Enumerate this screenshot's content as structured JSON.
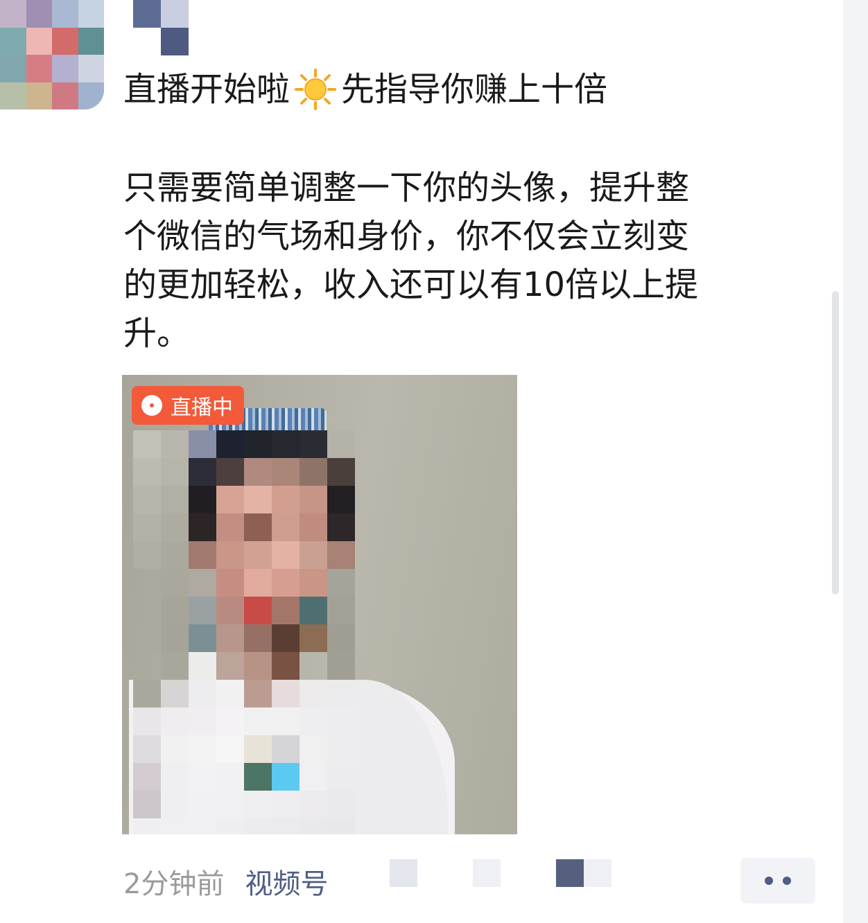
{
  "post": {
    "title_part1": "直播开始啦",
    "title_icon": "sun-icon",
    "title_part2": "先指导你赚上十倍",
    "body_lines": [
      "只需要简单调整一下你的头像，提升整",
      "个微信的气场和身价，你不仅会立刻变",
      "的更加轻松，收入还可以有10倍以上提",
      "升。"
    ]
  },
  "video": {
    "badge_icon": "live-dot-icon",
    "badge_label": "直播中",
    "badge_color": "#f25a3a"
  },
  "footer": {
    "timestamp": "2分钟前",
    "channel_label": "视频号",
    "more_icon": "more-dots-icon"
  },
  "colors": {
    "link": "#4f5d87",
    "timestamp": "#9a9a9a",
    "more_button_bg": "#f2f3f6"
  }
}
